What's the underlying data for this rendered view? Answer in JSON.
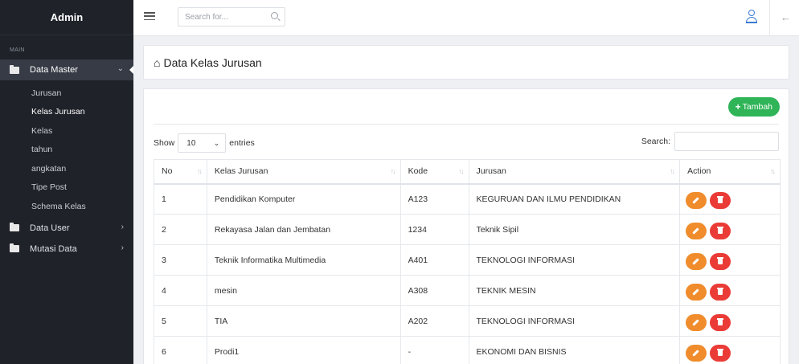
{
  "sidebar": {
    "brand": "Admin",
    "section": "MAIN",
    "menu": [
      {
        "label": "Data Master",
        "arrow": "⌄"
      },
      {
        "label": "Data User",
        "arrow": "›"
      },
      {
        "label": "Mutasi Data",
        "arrow": "›"
      }
    ],
    "submenu": [
      "Jurusan",
      "Kelas Jurusan",
      "Kelas",
      "tahun",
      "angkatan",
      "Tipe Post",
      "Schema Kelas"
    ]
  },
  "topbar": {
    "search_placeholder": "Search for..."
  },
  "page": {
    "title": "Data Kelas Jurusan"
  },
  "card": {
    "add_label": "Tambah",
    "show_label": "Show",
    "entries_value": "10",
    "entries_label": "entries",
    "search_label": "Search:"
  },
  "table": {
    "headers": [
      "No",
      "Kelas Jurusan",
      "Kode",
      "Jurusan",
      "Action"
    ],
    "rows": [
      {
        "no": "1",
        "kelas": "Pendidikan Komputer",
        "kode": "A123",
        "jurusan": "KEGURUAN DAN ILMU PENDIDIKAN"
      },
      {
        "no": "2",
        "kelas": "Rekayasa Jalan dan Jembatan",
        "kode": "1234",
        "jurusan": "Teknik Sipil"
      },
      {
        "no": "3",
        "kelas": "Teknik Informatika Multimedia",
        "kode": "A401",
        "jurusan": "TEKNOLOGI INFORMASI"
      },
      {
        "no": "4",
        "kelas": "mesin",
        "kode": "A308",
        "jurusan": "TEKNIK MESIN"
      },
      {
        "no": "5",
        "kelas": "TIA",
        "kode": "A202",
        "jurusan": "TEKNOLOGI INFORMASI"
      },
      {
        "no": "6",
        "kelas": "Prodi1",
        "kode": "-",
        "jurusan": "EKONOMI DAN BISNIS"
      }
    ]
  },
  "colors": {
    "sidebar_bg": "#1f2229",
    "add_button": "#2fb457",
    "edit_button": "#f08c2c",
    "delete_button": "#ea3b36",
    "user_icon": "#3a7bd5"
  },
  "icons": [
    "folder-icon",
    "hamburger-icon",
    "search-icon",
    "user-icon",
    "back-arrow-icon",
    "home-icon",
    "plus-icon",
    "sort-icon",
    "edit-icon",
    "delete-icon"
  ]
}
